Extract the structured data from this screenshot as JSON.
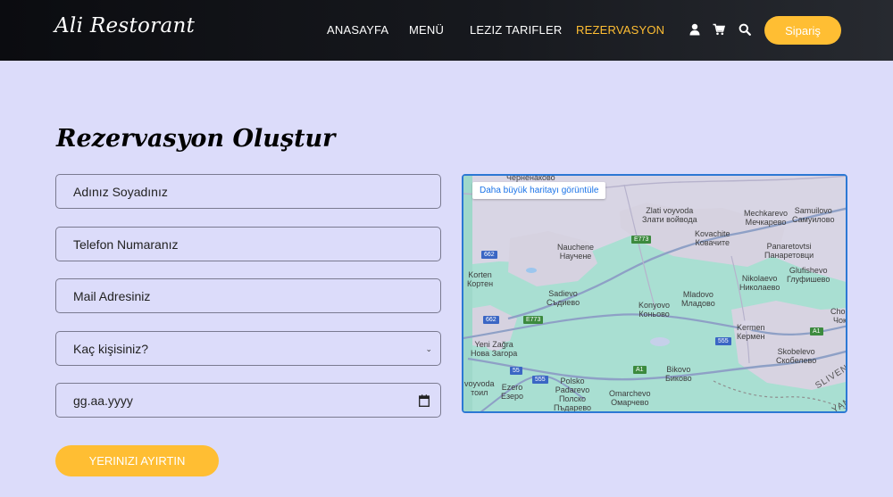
{
  "brand": "Ali Restorant",
  "nav": {
    "items": [
      {
        "label": "ANASAYFA",
        "active": false
      },
      {
        "label": "MENÜ",
        "active": false
      },
      {
        "label": "LEZIZ TARIFLER",
        "active": false
      },
      {
        "label": "REZERVASYON",
        "active": true
      }
    ],
    "icons": [
      "user-icon",
      "cart-icon",
      "search-icon"
    ],
    "order_button": "Sipariş"
  },
  "colors": {
    "accent": "#ffbe33",
    "nav_bg": "#111216",
    "page_bg": "#dcdcfa"
  },
  "form": {
    "title": "Rezervasyon Oluştur",
    "name_placeholder": "Adınız Soyadınız",
    "phone_placeholder": "Telefon Numaranız",
    "email_placeholder": "Mail Adresiniz",
    "guests_placeholder": "Kaç kişisiniz?",
    "date_placeholder": "gg.aa.yyyy",
    "submit_label": "YERINIZI AYIRTIN"
  },
  "map": {
    "larger_map_link": "Daha büyük haritayı görüntüle",
    "places": [
      {
        "name": "Черненаково",
        "extra": ""
      },
      {
        "name": "Zlati voyvoda",
        "extra": "Злати войвода"
      },
      {
        "name": "Mechkarevo",
        "extra": "Мечкарево"
      },
      {
        "name": "Samuilovo",
        "extra": "Самуилово"
      },
      {
        "name": "Kovachite",
        "extra": "Ковачите"
      },
      {
        "name": "Panaretovtsi",
        "extra": "Панаретовци"
      },
      {
        "name": "Nauchene",
        "extra": "Научене"
      },
      {
        "name": "Glufishevo",
        "extra": "Глуфишево"
      },
      {
        "name": "Korten",
        "extra": "Кортен"
      },
      {
        "name": "Nikolaevo",
        "extra": "Николаево"
      },
      {
        "name": "Sadievo",
        "extra": "Съдиево"
      },
      {
        "name": "Mladovo",
        "extra": "Младово"
      },
      {
        "name": "Konyovo",
        "extra": "Коньово"
      },
      {
        "name": "Kermen",
        "extra": "Кермен"
      },
      {
        "name": "Yeni Zağra",
        "extra": "Нова Загора"
      },
      {
        "name": "Skobelevo",
        "extra": "Скобелево"
      },
      {
        "name": "Bikovo",
        "extra": "Биково"
      },
      {
        "name": "voyvoda",
        "extra": "тоил"
      },
      {
        "name": "Ezero",
        "extra": "Езеро"
      },
      {
        "name": "Polsko Padarevo",
        "extra": "Полско Пъдарево"
      },
      {
        "name": "Omarchevo",
        "extra": "Омарчево"
      },
      {
        "name": "Chok",
        "extra": "Чок"
      },
      {
        "name": "SLIVEN",
        "extra": ""
      },
      {
        "name": "YAM",
        "extra": ""
      }
    ],
    "road_labels": [
      "E773",
      "662",
      "662",
      "E773",
      "555",
      "55",
      "555",
      "A1",
      "A1"
    ]
  }
}
